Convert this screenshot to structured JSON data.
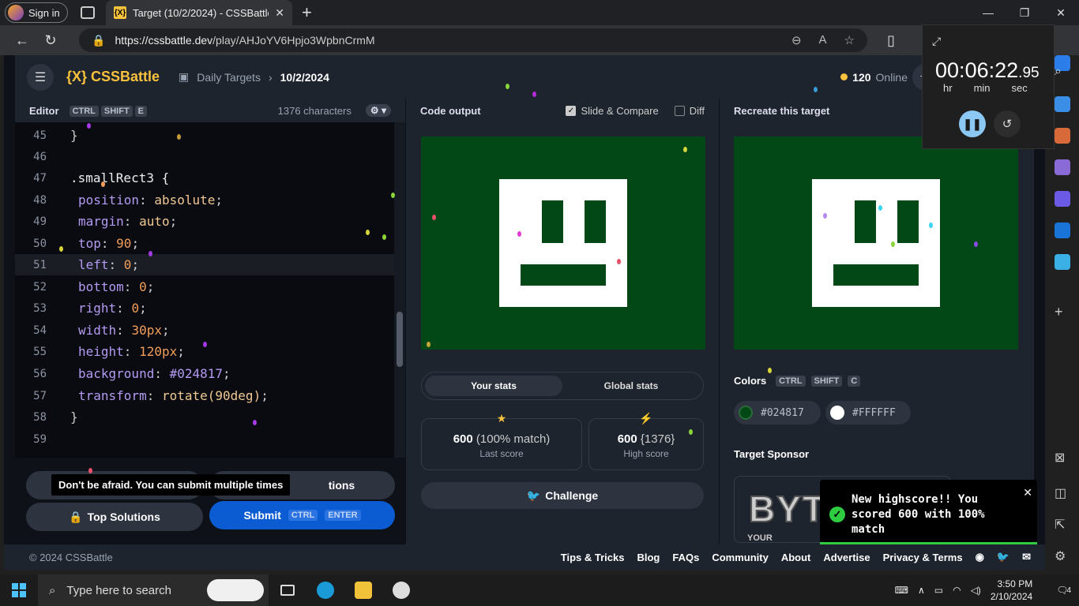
{
  "browser": {
    "signin": "Sign in",
    "tab_title": "Target (10/2/2024) - CSSBattle",
    "favicon": "{X}",
    "url_host": "https://cssbattle.dev",
    "url_path": "/play/AHJoYV6Hpjo3WpbnCrmM"
  },
  "nav": {
    "logo": "{X} CSSBattle",
    "crumb_root": "Daily Targets",
    "crumb_current": "10/2/2024",
    "online_count": "120",
    "online_label": "Online"
  },
  "editor": {
    "title": "Editor",
    "keys": [
      "CTRL",
      "SHIFT",
      "E"
    ],
    "char_count": "1376 characters",
    "lines": [
      {
        "n": "45",
        "text": "}"
      },
      {
        "n": "46",
        "text": ""
      },
      {
        "n": "47",
        "text": ".smallRect3 {"
      },
      {
        "n": "48",
        "prop": "position",
        "val": "absolute"
      },
      {
        "n": "49",
        "prop": "margin",
        "val": "auto"
      },
      {
        "n": "50",
        "prop": "top",
        "val": "90"
      },
      {
        "n": "51",
        "prop": "left",
        "val": "0"
      },
      {
        "n": "52",
        "prop": "bottom",
        "val": "0"
      },
      {
        "n": "53",
        "prop": "right",
        "val": "0"
      },
      {
        "n": "54",
        "prop": "width",
        "val": "30px"
      },
      {
        "n": "55",
        "prop": "height",
        "val": "120px"
      },
      {
        "n": "56",
        "prop": "background",
        "val": "#024817"
      },
      {
        "n": "57",
        "prop": "transform",
        "val": "rotate(90deg)"
      },
      {
        "n": "58",
        "text": "}"
      },
      {
        "n": "59",
        "text": ""
      }
    ]
  },
  "actions": {
    "tooltip": "Don't be afraid. You can submit multiple times",
    "solutions_label": "tions",
    "top_solutions": "Top Solutions",
    "submit": "Submit",
    "submit_keys": [
      "CTRL",
      "ENTER"
    ]
  },
  "output": {
    "title": "Code output",
    "slide_compare": "Slide & Compare",
    "diff": "Diff",
    "tab_your": "Your stats",
    "tab_global": "Global stats",
    "last_score": "600",
    "last_match": "(100% match)",
    "last_label": "Last score",
    "high_score": "600",
    "high_chars": "{1376}",
    "high_label": "High score",
    "challenge": "Challenge"
  },
  "target": {
    "title": "Recreate this target",
    "colors_label": "Colors",
    "color_keys": [
      "CTRL",
      "SHIFT",
      "C"
    ],
    "color1": "#024817",
    "color2": "#FFFFFF",
    "sponsor_label": "Target Sponsor",
    "sponsor_logo": "BYT",
    "sponsor_sub": "YOUR"
  },
  "toast": {
    "message": "New highscore!! You scored 600 with 100% match"
  },
  "timer": {
    "hh": "00",
    "mm": "06",
    "ss": "22",
    "cs": ".95",
    "hr": "hr",
    "min": "min",
    "sec": "sec"
  },
  "footer": {
    "copyright": "© 2024 CSSBattle",
    "links": [
      "Tips & Tricks",
      "Blog",
      "FAQs",
      "Community",
      "About",
      "Advertise",
      "Privacy & Terms"
    ]
  },
  "taskbar": {
    "search_placeholder": "Type here to search",
    "time": "3:50 PM",
    "date": "2/10/2024",
    "notif_count": "4"
  },
  "colors": {
    "target_green": "#024817",
    "accent_yellow": "#f9c23c",
    "submit_blue": "#0b5bd3"
  }
}
